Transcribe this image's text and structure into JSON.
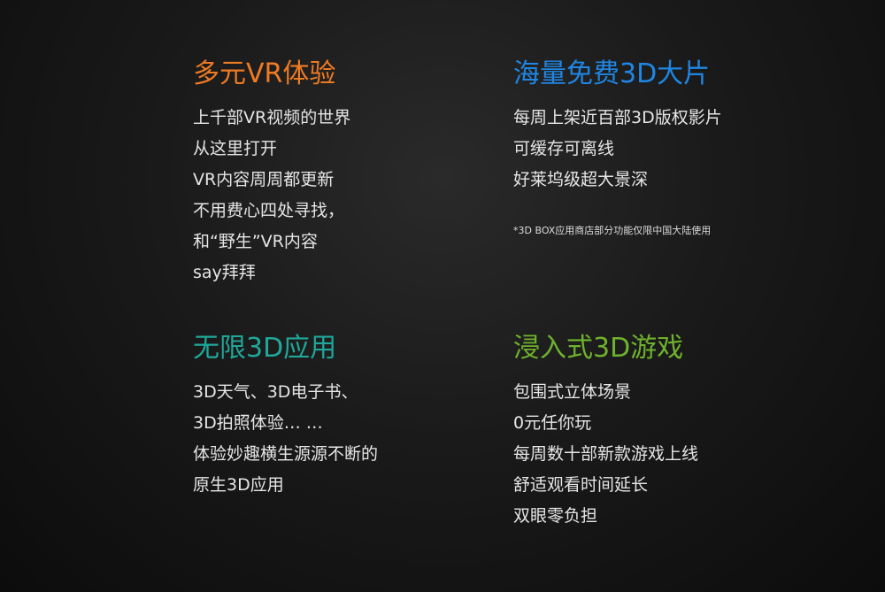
{
  "colors": {
    "orange": "#ef7a24",
    "blue": "#1f86e3",
    "teal": "#1fa89a",
    "green": "#6fb22c",
    "text": "#e6e6e6"
  },
  "sections": [
    {
      "title": "多元VR体验",
      "lines": [
        "上千部VR视频的世界",
        "从这里打开",
        "VR内容周周都更新",
        "不用费心四处寻找，",
        "和“野生”VR内容",
        "say拜拜"
      ]
    },
    {
      "title": "海量免费3D大片",
      "lines": [
        "每周上架近百部3D版权影片",
        "可缓存可离线",
        "好莱坞级超大景深"
      ],
      "note": "*3D BOX应用商店部分功能仅限中国大陆使用"
    },
    {
      "title": "无限3D应用",
      "lines": [
        "3D天气、3D电子书、",
        "3D拍照体验… …",
        "体验妙趣横生源源不断的",
        "原生3D应用"
      ]
    },
    {
      "title": "浸入式3D游戏",
      "lines": [
        "包围式立体场景",
        "0元任你玩",
        "每周数十部新款游戏上线",
        "舒适观看时间延长",
        "双眼零负担"
      ]
    }
  ]
}
